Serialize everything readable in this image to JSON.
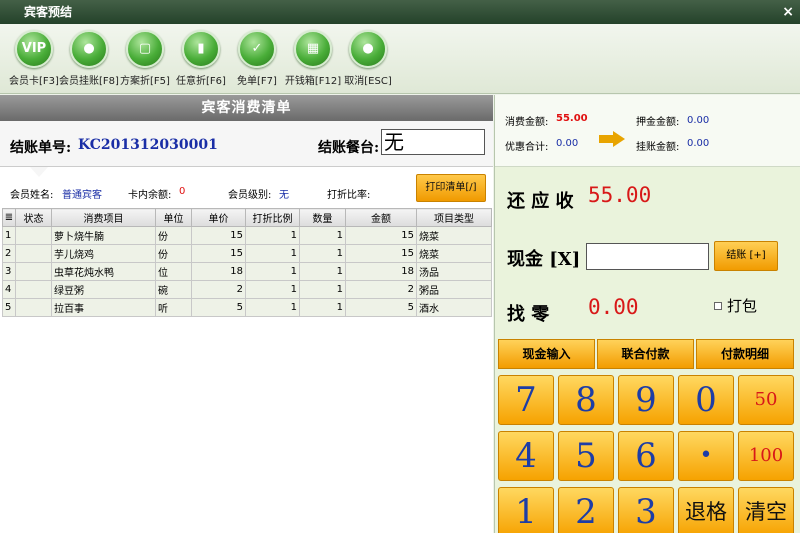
{
  "window": {
    "title": "宾客预结",
    "close": "×"
  },
  "toolbar": [
    {
      "label": "会员卡[F3]",
      "icon": "vip-icon",
      "glyph": "VIP"
    },
    {
      "label": "会员挂账[F8]",
      "icon": "member-charge-icon",
      "glyph": "●"
    },
    {
      "label": "方案折[F5]",
      "icon": "plan-discount-icon",
      "glyph": "▢"
    },
    {
      "label": "任意折[F6]",
      "icon": "any-discount-icon",
      "glyph": "▮"
    },
    {
      "label": "免单[F7]",
      "icon": "free-order-icon",
      "glyph": "✓"
    },
    {
      "label": "开钱箱[F12]",
      "icon": "cash-drawer-icon",
      "glyph": "▦"
    },
    {
      "label": "取消[ESC]",
      "icon": "cancel-icon",
      "glyph": "●"
    }
  ],
  "bill": {
    "title": "宾客消费清单",
    "bill_no_label": "结账单号:",
    "bill_no": "KC201312030001",
    "table_label": "结账餐台:",
    "table_value": "无",
    "member_name_label": "会员姓名:",
    "member_name": "普通宾客",
    "card_balance_label": "卡内余额:",
    "card_balance": "0",
    "member_level_label": "会员级别:",
    "member_level": "无",
    "discount_rate_label": "打折比率:",
    "discount_rate": "",
    "print_button": "打印清单[/]"
  },
  "grid": {
    "columns": [
      "",
      "状态",
      "消费项目",
      "单位",
      "单价",
      "打折比例",
      "数量",
      "金额",
      "项目类型"
    ],
    "rows": [
      [
        "1",
        "",
        "萝卜烧牛腩",
        "份",
        "15",
        "1",
        "1",
        "15",
        "烧菜"
      ],
      [
        "2",
        "",
        "芋儿烧鸡",
        "份",
        "15",
        "1",
        "1",
        "15",
        "烧菜"
      ],
      [
        "3",
        "",
        "虫草花炖水鸭",
        "位",
        "18",
        "1",
        "1",
        "18",
        "汤品"
      ],
      [
        "4",
        "",
        "绿豆粥",
        "碗",
        "2",
        "1",
        "1",
        "2",
        "粥品"
      ],
      [
        "5",
        "",
        "拉百事",
        "听",
        "5",
        "1",
        "1",
        "5",
        "酒水"
      ]
    ]
  },
  "summary": {
    "consume_label": "消费金额:",
    "consume_value": "55.00",
    "deposit_label": "押金金额:",
    "deposit_value": "0.00",
    "discount_label": "优惠合计:",
    "discount_value": "0.00",
    "charge_label": "挂账金额:",
    "charge_value": "0.00"
  },
  "payment": {
    "receivable_label": "还 应 收",
    "receivable_value": "55.00",
    "cash_label": "现金 [X]",
    "cash_value": "",
    "settle_button": "结账 [+]",
    "change_label": "找    零",
    "change_value": "0.00",
    "pack_label": "打包"
  },
  "functions": [
    "现金输入",
    "联合付款",
    "付款明细"
  ],
  "keypad": [
    "7",
    "8",
    "9",
    "0",
    "50",
    "4",
    "5",
    "6",
    "•",
    "100",
    "1",
    "2",
    "3",
    "退格",
    "清空"
  ]
}
